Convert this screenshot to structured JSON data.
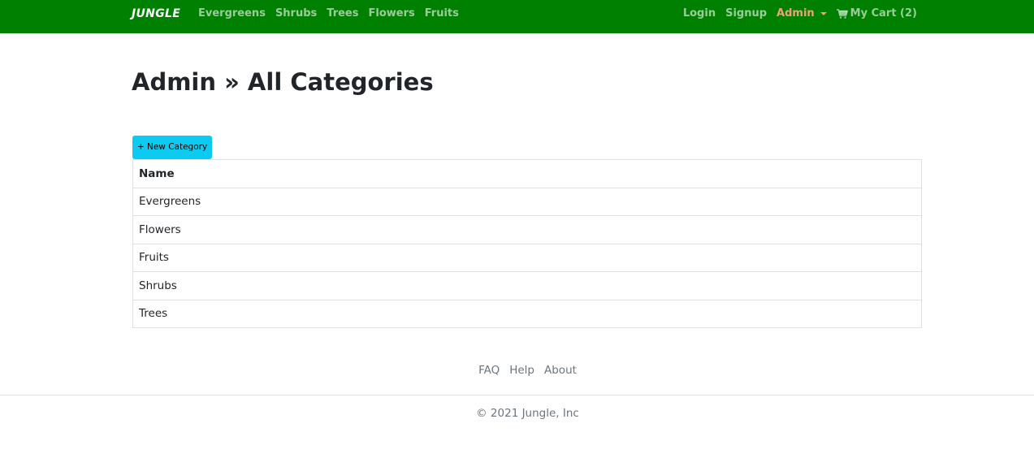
{
  "navbar": {
    "brand": "JUNGLE",
    "categories": [
      "Evergreens",
      "Shrubs",
      "Trees",
      "Flowers",
      "Fruits"
    ],
    "login": "Login",
    "signup": "Signup",
    "admin": "Admin",
    "cart": "My Cart (2)",
    "colors": {
      "background": "#008000",
      "admin": "#f0a07a"
    }
  },
  "main": {
    "title": "Admin » All Categories",
    "new_button": "+ New Category",
    "table": {
      "header": "Name",
      "rows": [
        "Evergreens",
        "Flowers",
        "Fruits",
        "Shrubs",
        "Trees"
      ]
    }
  },
  "footer": {
    "links": [
      "FAQ",
      "Help",
      "About"
    ],
    "copyright": "© 2021 Jungle, Inc"
  }
}
